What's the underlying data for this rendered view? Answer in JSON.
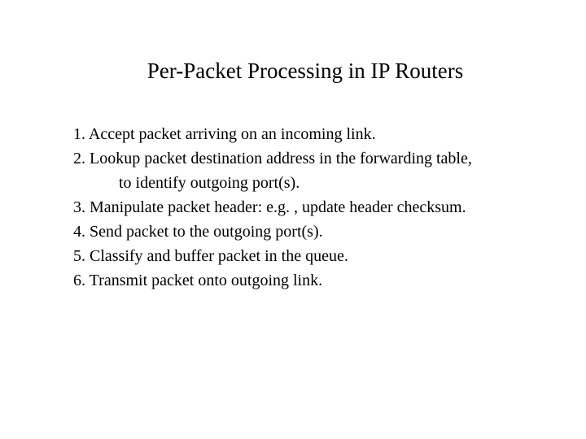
{
  "title": "Per-Packet Processing in IP Routers",
  "items": [
    {
      "text": "1. Accept packet arriving on an incoming link."
    },
    {
      "text": "2. Lookup packet destination address in the forwarding table,"
    },
    {
      "text": "to identify outgoing port(s).",
      "cont": true
    },
    {
      "text": "3. Manipulate packet header: e.g. , update header checksum."
    },
    {
      "text": "4. Send packet to the outgoing port(s)."
    },
    {
      "text": "5. Classify and buffer packet in the queue."
    },
    {
      "text": "6. Transmit packet onto outgoing link."
    }
  ]
}
